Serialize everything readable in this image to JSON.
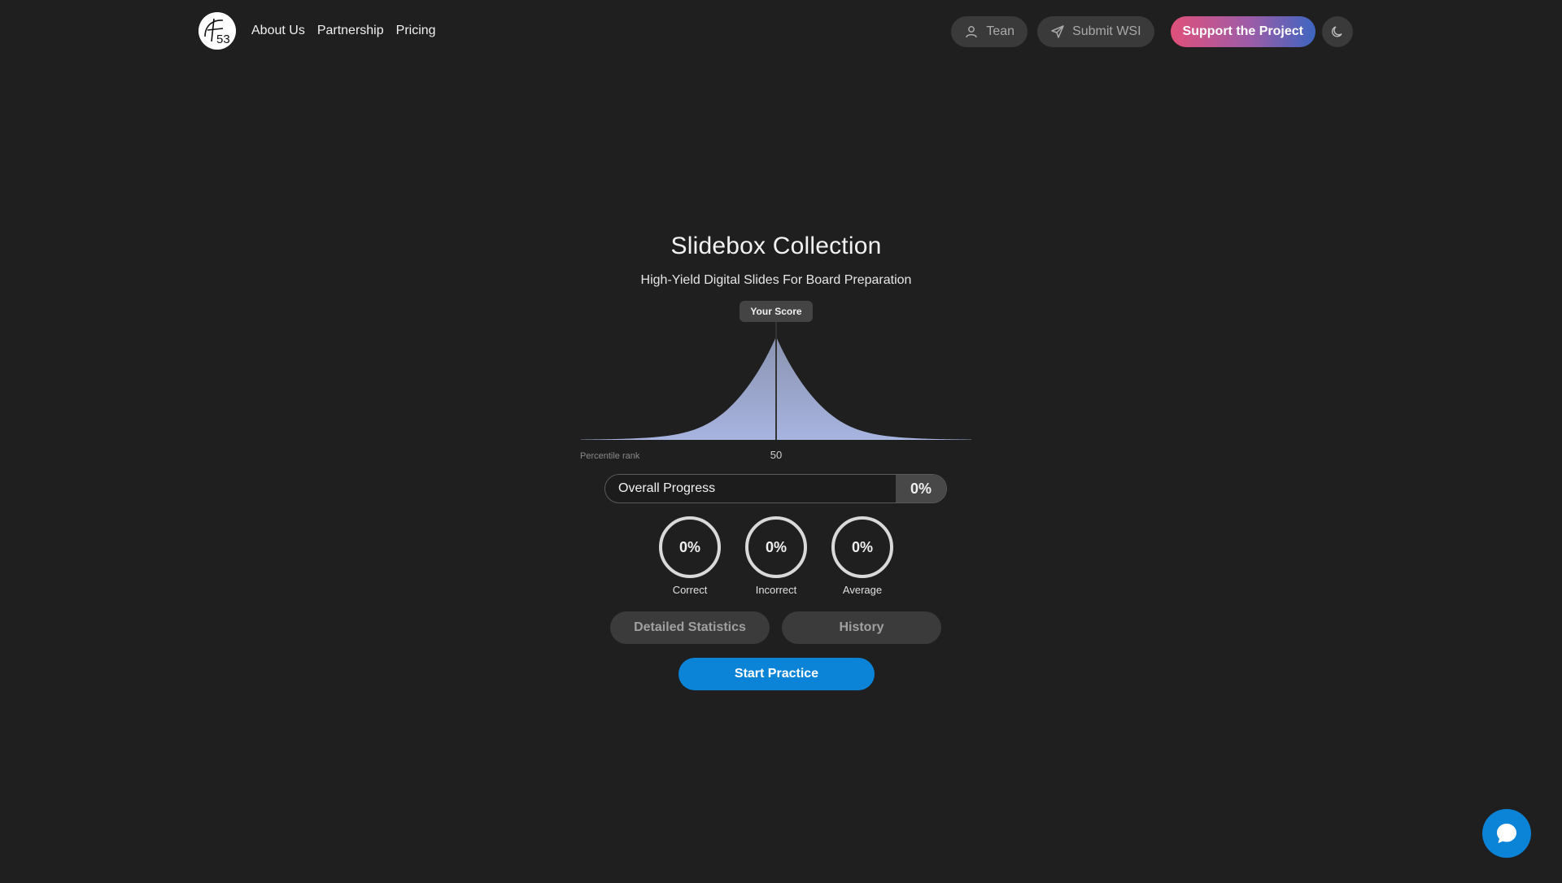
{
  "header": {
    "logo_label": "53",
    "nav": [
      {
        "label": "About Us"
      },
      {
        "label": "Partnership"
      },
      {
        "label": "Pricing"
      }
    ],
    "user_label": "Tean",
    "submit_label": "Submit WSI",
    "support_label": "Support the Project"
  },
  "main": {
    "title": "Slidebox Collection",
    "subtitle": "High-Yield Digital Slides For Board Preparation",
    "score_tag": "Your Score",
    "progress": {
      "label": "Overall Progress",
      "value": "0%"
    },
    "rings": [
      {
        "value": "0%",
        "label": "Correct"
      },
      {
        "value": "0%",
        "label": "Incorrect"
      },
      {
        "value": "0%",
        "label": "Average"
      }
    ],
    "buttons": {
      "detailed": "Detailed Statistics",
      "history": "History",
      "start": "Start Practice"
    }
  },
  "chart_data": {
    "type": "area",
    "xlabel": "Percentile rank",
    "marker": {
      "x": 50,
      "label": "50"
    },
    "xlim": [
      0,
      100
    ],
    "grid": false,
    "legend": "none",
    "colors": {
      "fill_top": "#8a93b0",
      "fill_bottom": "#a7b4e0",
      "marker": "#333333"
    }
  },
  "colors": {
    "background": "#1f1f1f",
    "accent": "#0b84d8",
    "support_gradient": [
      "#e0507a",
      "#9c5ca8",
      "#3d66c0"
    ]
  }
}
